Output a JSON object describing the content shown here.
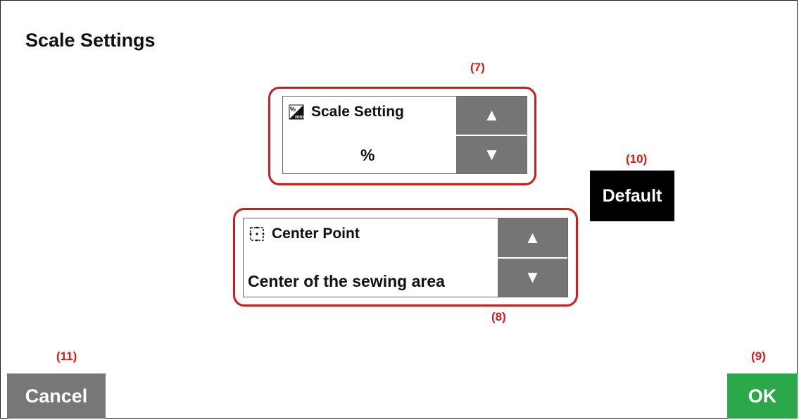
{
  "title": "Scale Settings",
  "callouts": {
    "c7": "(7)",
    "c8": "(8)",
    "c9": "(9)",
    "c10": "(10)",
    "c11": "(11)"
  },
  "scale_setting": {
    "label": "Scale Setting",
    "value": "%",
    "icon": "percent-mm-icon",
    "up": "▲",
    "down": "▼"
  },
  "center_point": {
    "label": "Center Point",
    "value": "Center of the sewing area",
    "icon": "center-point-icon",
    "up": "▲",
    "down": "▼"
  },
  "buttons": {
    "default": "Default",
    "cancel": "Cancel",
    "ok": "OK"
  },
  "colors": {
    "callout": "#d51a1a",
    "arrow_button": "#757575",
    "default_button": "#000000",
    "cancel_button": "#777777",
    "ok_button": "#2aa84a"
  }
}
